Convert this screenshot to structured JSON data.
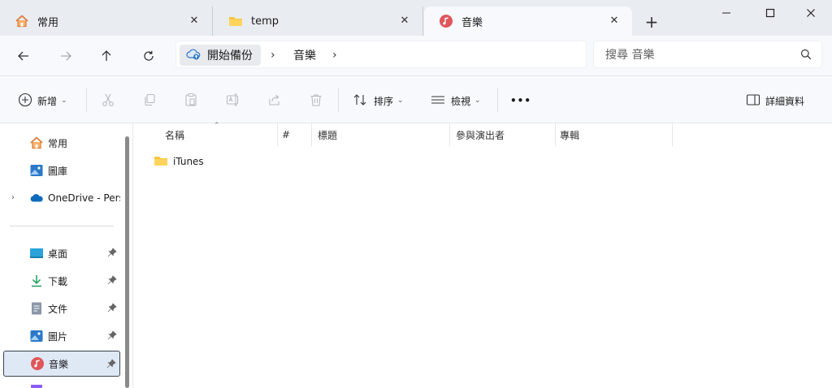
{
  "tabs": [
    {
      "label": "常用",
      "icon": "home-icon",
      "active": false
    },
    {
      "label": "temp",
      "icon": "folder-icon",
      "active": false
    },
    {
      "label": "音樂",
      "icon": "music-icon",
      "active": true
    }
  ],
  "newtab_label": "+",
  "window_controls": {
    "minimize": "minimize-icon",
    "maximize": "maximize-icon",
    "close": "close-icon"
  },
  "address": {
    "breadcrumbs": [
      "開始備份",
      "音樂"
    ],
    "separator": "›"
  },
  "search": {
    "placeholder": "搜尋 音樂"
  },
  "toolbar": {
    "new_label": "新增",
    "sort_label": "排序",
    "view_label": "檢視",
    "details_label": "詳細資料",
    "more": "•••"
  },
  "sidebar": {
    "items": [
      {
        "label": "常用",
        "icon": "home-icon"
      },
      {
        "label": "圖庫",
        "icon": "gallery-icon"
      },
      {
        "label": "OneDrive - Pers",
        "icon": "onedrive-icon"
      },
      {
        "label": "桌面",
        "icon": "desktop-icon",
        "pinned": true
      },
      {
        "label": "下載",
        "icon": "download-icon",
        "pinned": true
      },
      {
        "label": "文件",
        "icon": "document-icon",
        "pinned": true
      },
      {
        "label": "圖片",
        "icon": "pictures-icon",
        "pinned": true
      },
      {
        "label": "音樂",
        "icon": "music-icon",
        "pinned": true,
        "selected": true
      }
    ]
  },
  "columns": [
    "名稱",
    "#",
    "標題",
    "參與演出者",
    "專輯"
  ],
  "files": [
    {
      "name": "iTunes",
      "type": "folder"
    }
  ],
  "colors": {
    "accent": "#0067c0",
    "folder": "#f4c542",
    "music": "#e0565b",
    "selected_bg": "#dfe9f6"
  }
}
